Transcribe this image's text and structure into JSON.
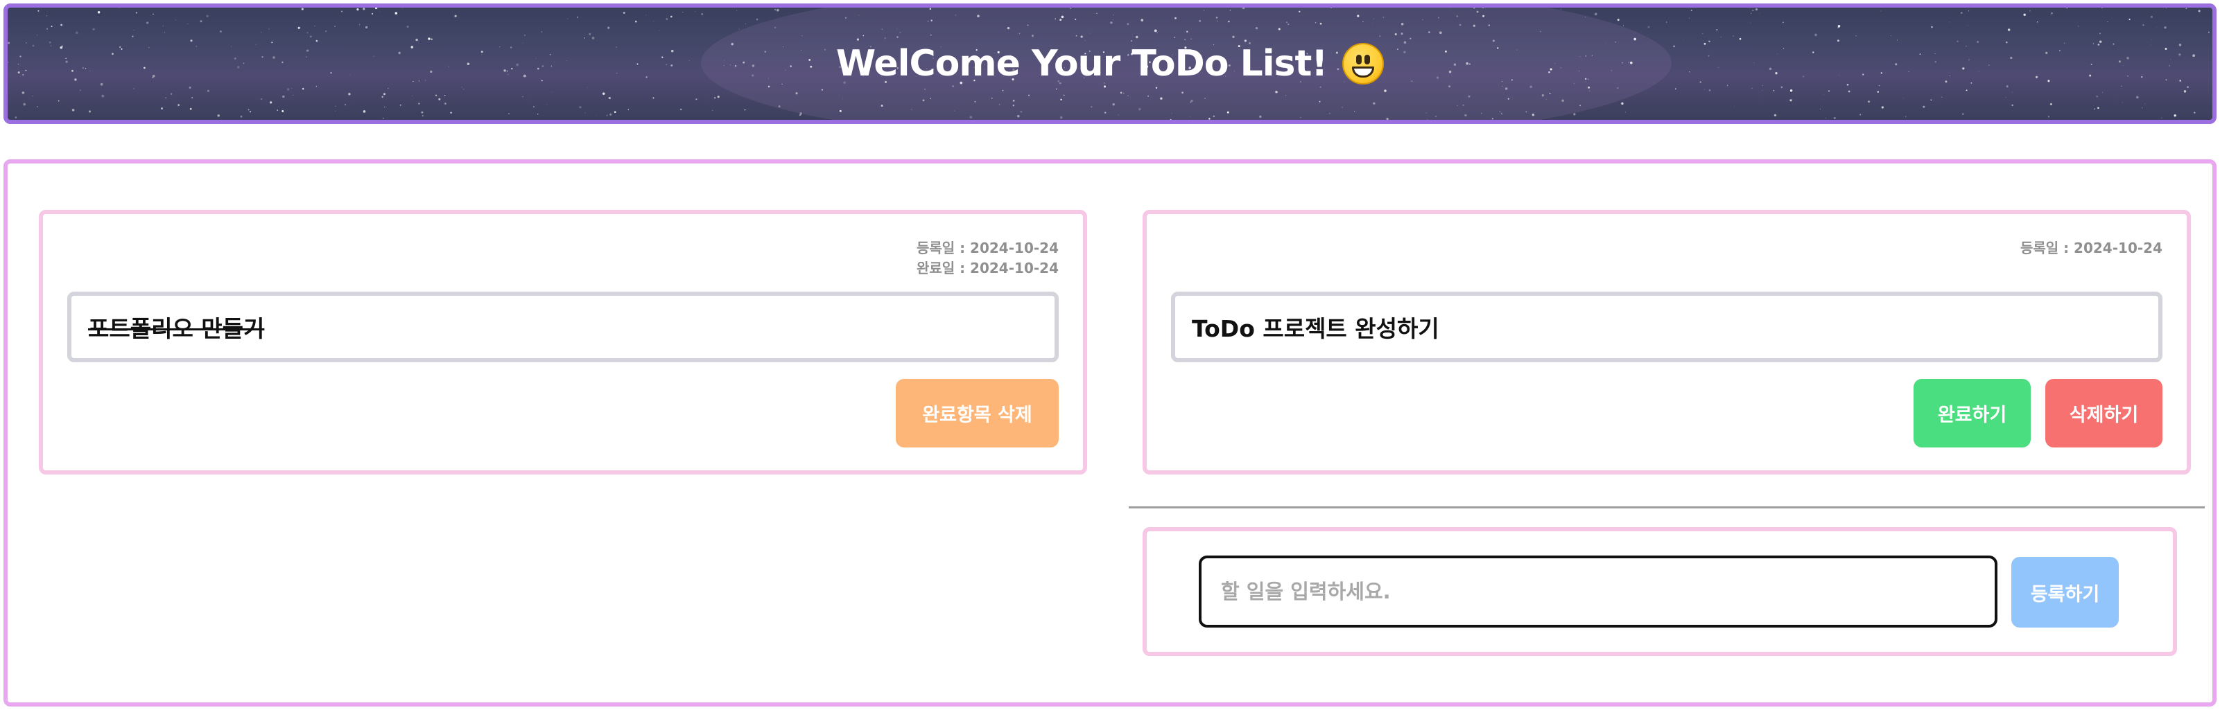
{
  "header": {
    "title": "WelCome Your ToDo List!",
    "emoji": "grinning-face-icon"
  },
  "todos": [
    {
      "text": "포트폴리오 만들기",
      "registered": "등록일 : 2024-10-24",
      "completed": "완료일 : 2024-10-24",
      "done": true,
      "actions": {
        "clear_label": "완료항목 삭제"
      }
    },
    {
      "text": "ToDo 프로젝트 완성하기",
      "registered": "등록일 : 2024-10-24",
      "done": false,
      "actions": {
        "complete_label": "완료하기",
        "delete_label": "삭제하기"
      }
    }
  ],
  "form": {
    "placeholder": "할 일을 입력하세요.",
    "value": "",
    "submit_label": "등록하기"
  },
  "colors": {
    "header_border": "#9b6fe0",
    "main_border": "#e7a8f0",
    "card_border": "#f7c8e6",
    "clear_button": "#fdb677",
    "complete_button": "#4ade80",
    "delete_button": "#f87171",
    "register_button": "#93c5fd"
  }
}
